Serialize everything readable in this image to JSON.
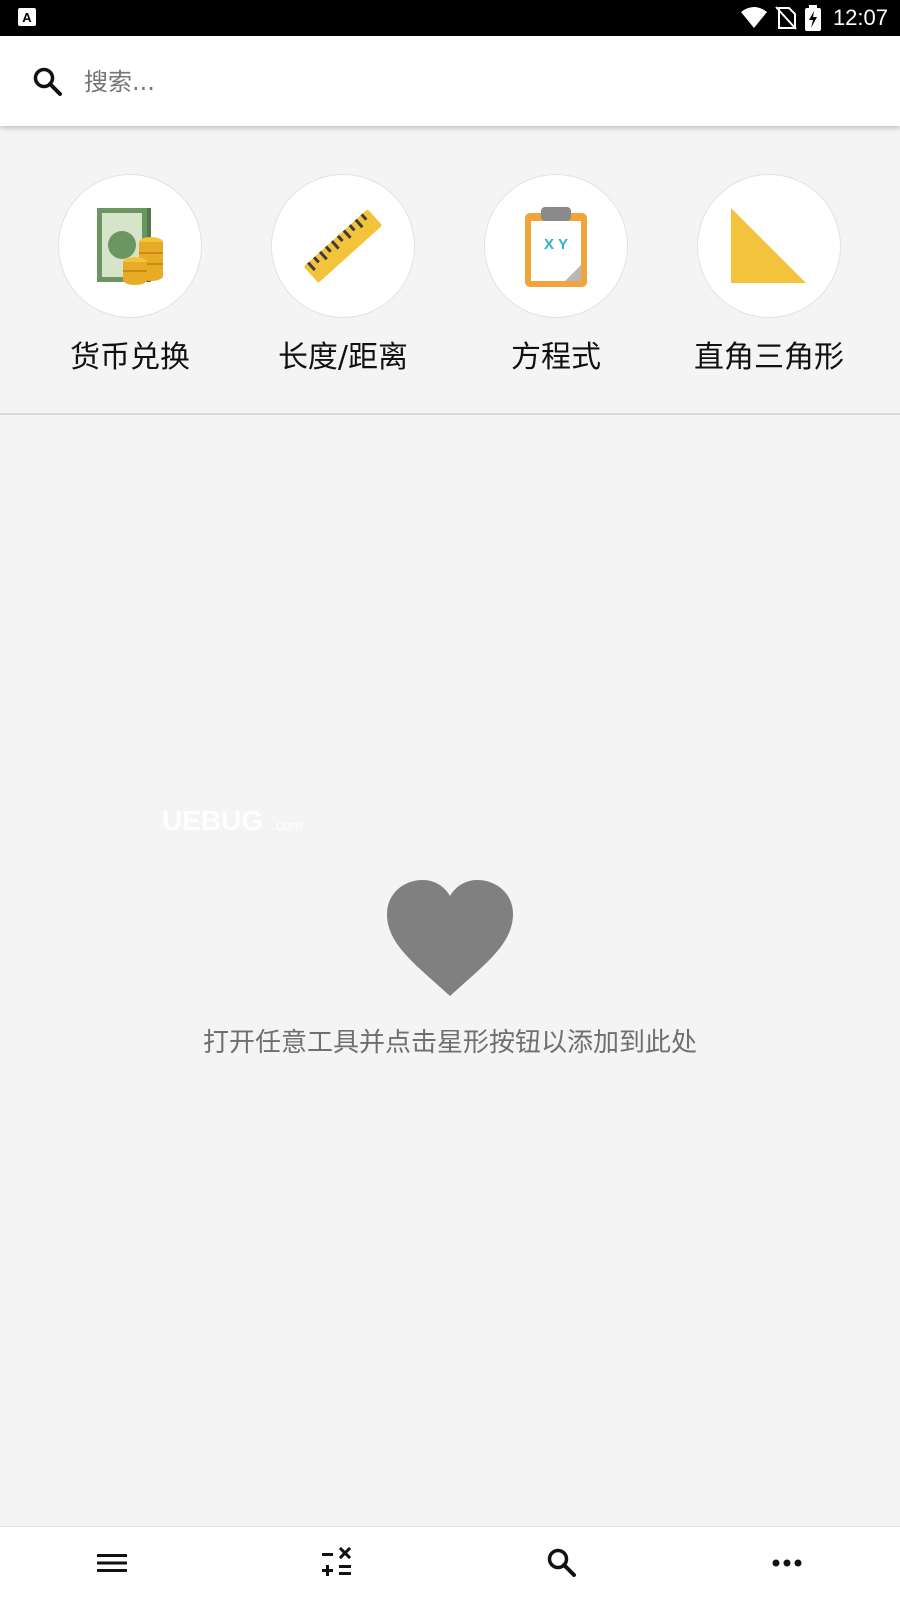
{
  "status_bar": {
    "time": "12:07",
    "icons": [
      "app-notification-icon",
      "wifi-icon",
      "no-sim-icon",
      "battery-charging-icon"
    ]
  },
  "search": {
    "placeholder": "搜索..."
  },
  "tools": [
    {
      "label": "货币兑换",
      "icon": "currency-exchange-icon"
    },
    {
      "label": "长度/距离",
      "icon": "ruler-icon"
    },
    {
      "label": "方程式",
      "icon": "clipboard-xy-icon"
    },
    {
      "label": "直角三角形",
      "icon": "right-triangle-icon"
    }
  ],
  "favorites": {
    "empty_message": "打开任意工具并点击星形按钮以添加到此处",
    "icon": "heart-icon"
  },
  "watermark": "UEBUG.com",
  "bottom_nav": {
    "items": [
      "menu-icon",
      "calculator-ops-icon",
      "search-icon",
      "more-icon"
    ]
  },
  "colors": {
    "background": "#f4f4f4",
    "accent_yellow": "#f4c33c",
    "heart_gray": "#808080",
    "money_green": "#5f8b55"
  }
}
